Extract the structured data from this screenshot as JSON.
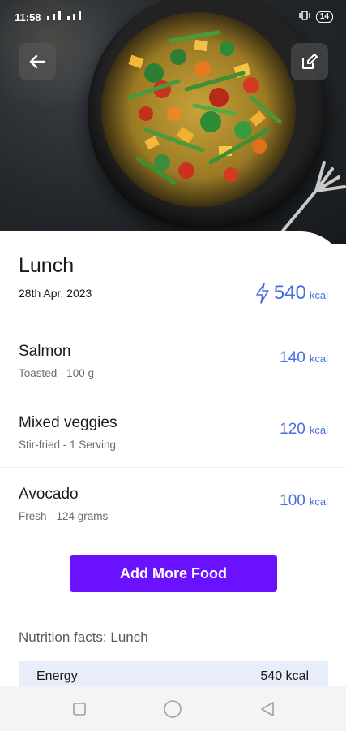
{
  "status_bar": {
    "time": "11:58",
    "battery": "14"
  },
  "meal": {
    "title": "Lunch",
    "date": "28th Apr, 2023",
    "total_kcal": "540",
    "kcal_unit": "kcal"
  },
  "foods": [
    {
      "name": "Salmon",
      "desc": "Toasted - 100 g",
      "kcal": "140",
      "unit": "kcal"
    },
    {
      "name": "Mixed veggies",
      "desc": "Stir-fried - 1 Serving",
      "kcal": "120",
      "unit": "kcal"
    },
    {
      "name": "Avocado",
      "desc": "Fresh - 124 grams",
      "kcal": "100",
      "unit": "kcal"
    }
  ],
  "actions": {
    "add_more_food": "Add More Food"
  },
  "nutrition": {
    "title": "Nutrition facts: Lunch",
    "rows": [
      {
        "label": "Energy",
        "value": "540 kcal"
      }
    ]
  },
  "icons": {
    "back": "back-arrow-icon",
    "edit": "edit-icon",
    "calories": "lightning-icon",
    "nav_recents": "square-icon",
    "nav_home": "circle-icon",
    "nav_back": "triangle-back-icon"
  },
  "colors": {
    "accent": "#4a6ee0",
    "button": "#6a11ff",
    "nutrition_row_bg": "#e8edfb"
  }
}
